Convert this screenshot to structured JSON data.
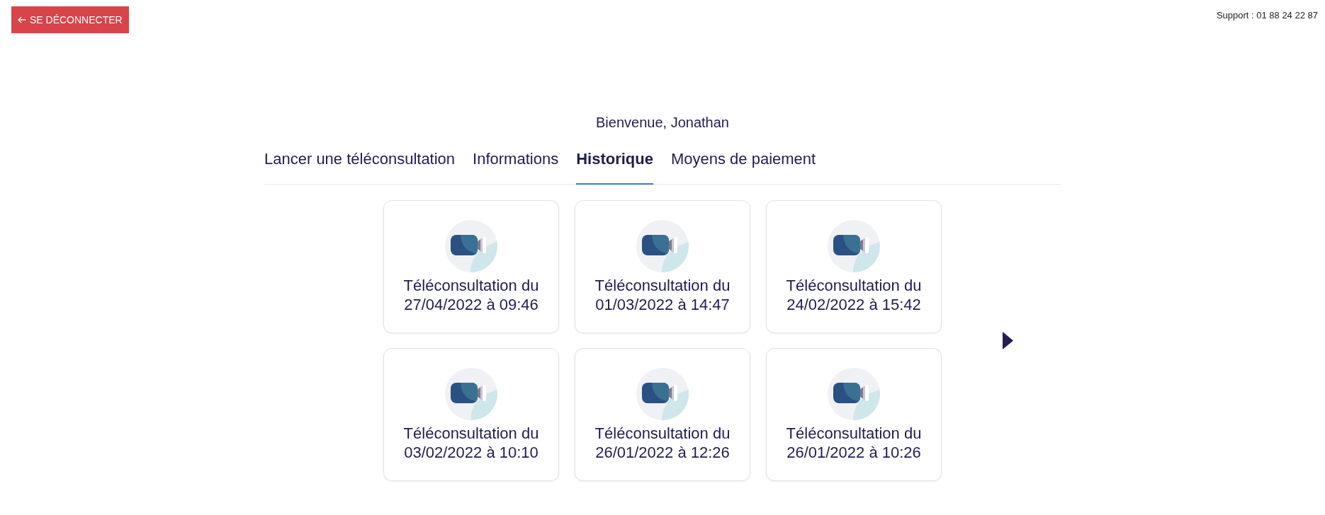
{
  "logout_button": {
    "label": "SE DÉCONNECTER"
  },
  "support": "Support : 01 88 24 22 87",
  "welcome": "Bienvenue, Jonathan",
  "tabs": [
    {
      "label": "Lancer une téléconsultation",
      "selected": false
    },
    {
      "label": "Informations",
      "selected": false
    },
    {
      "label": "Historique",
      "selected": true
    },
    {
      "label": "Moyens de paiement",
      "selected": false
    }
  ],
  "consultations": [
    {
      "title": "Téléconsultation du 27/04/2022 à 09:46"
    },
    {
      "title": "Téléconsultation du 01/03/2022 à 14:47"
    },
    {
      "title": "Téléconsultation du 24/02/2022 à 15:42"
    },
    {
      "title": "Téléconsultation du 03/02/2022 à 10:10"
    },
    {
      "title": "Téléconsultation du 26/01/2022 à 12:26"
    },
    {
      "title": "Téléconsultation du 26/01/2022 à 10:26"
    }
  ]
}
